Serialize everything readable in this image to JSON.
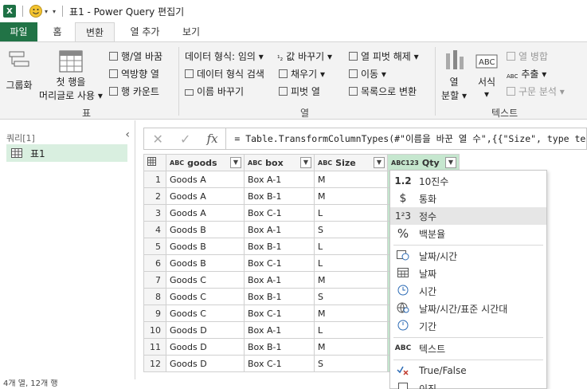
{
  "titlebar": {
    "logo": "X",
    "title": "표1 - Power Query 편집기"
  },
  "tabs": [
    {
      "label": "파일"
    },
    {
      "label": "홈"
    },
    {
      "label": "변환"
    },
    {
      "label": "열 추가"
    },
    {
      "label": "보기"
    }
  ],
  "ribbon": {
    "table_group": {
      "group_by": "그룹화",
      "promote_headers": "첫 행을",
      "promote_headers2": "머리글로 사용",
      "transpose": "행/열 바꿈",
      "reverse_rows": "역방향 열",
      "count_rows": "행 카운트",
      "label": "표"
    },
    "any_column_group": {
      "data_type": "데이터 형식: 임의",
      "detect_type": "데이터 형식 검색",
      "rename": "이름 바꾸기",
      "replace_values": "값 바꾸기",
      "fill": "채우기",
      "pivot": "피벗 열",
      "unpivot": "열 피벗 해제",
      "move": "이동",
      "to_list": "목록으로 변환",
      "label": "열"
    },
    "text_group": {
      "split": "열",
      "split2": "분할",
      "format": "서식",
      "merge": "열 병합",
      "extract": "추출",
      "parse": "구문 분석",
      "label": "텍스트"
    }
  },
  "query_pane": {
    "header": "쿼리[1]",
    "item": "표1"
  },
  "formula": "= Table.TransformColumnTypes(#\"이름을 바꾼 열 수\",{{\"Size\", type text}",
  "columns": [
    {
      "name": "goods",
      "type": "ABC"
    },
    {
      "name": "box",
      "type": "ABC"
    },
    {
      "name": "Size",
      "type": "ABC"
    },
    {
      "name": "Qty",
      "type": "ABC123"
    }
  ],
  "rows": [
    {
      "n": "1",
      "goods": "Goods A",
      "box": "Box A-1",
      "size": "M"
    },
    {
      "n": "2",
      "goods": "Goods A",
      "box": "Box B-1",
      "size": "M"
    },
    {
      "n": "3",
      "goods": "Goods A",
      "box": "Box C-1",
      "size": "L"
    },
    {
      "n": "4",
      "goods": "Goods B",
      "box": "Box A-1",
      "size": "S"
    },
    {
      "n": "5",
      "goods": "Goods B",
      "box": "Box B-1",
      "size": "L"
    },
    {
      "n": "6",
      "goods": "Goods B",
      "box": "Box C-1",
      "size": "L"
    },
    {
      "n": "7",
      "goods": "Goods C",
      "box": "Box A-1",
      "size": "M"
    },
    {
      "n": "8",
      "goods": "Goods C",
      "box": "Box B-1",
      "size": "S"
    },
    {
      "n": "9",
      "goods": "Goods C",
      "box": "Box C-1",
      "size": "M"
    },
    {
      "n": "10",
      "goods": "Goods D",
      "box": "Box A-1",
      "size": "L"
    },
    {
      "n": "11",
      "goods": "Goods D",
      "box": "Box B-1",
      "size": "M"
    },
    {
      "n": "12",
      "goods": "Goods D",
      "box": "Box C-1",
      "size": "S"
    }
  ],
  "menu": [
    {
      "icon": "1.2",
      "label": "10진수"
    },
    {
      "icon": "$",
      "label": "통화"
    },
    {
      "icon": "1²3",
      "label": "정수"
    },
    {
      "icon": "%",
      "label": "백분율"
    },
    {
      "icon": "datetime-icon",
      "label": "날짜/시간"
    },
    {
      "icon": "date-icon",
      "label": "날짜"
    },
    {
      "icon": "time-icon",
      "label": "시간"
    },
    {
      "icon": "timezone-icon",
      "label": "날짜/시간/표준 시간대"
    },
    {
      "icon": "duration-icon",
      "label": "기간"
    },
    {
      "icon": "ABC",
      "label": "텍스트"
    },
    {
      "icon": "check-x-icon",
      "label": "True/False"
    },
    {
      "icon": "binary-icon",
      "label": "이진"
    }
  ],
  "status": "4개 열, 12개 행"
}
